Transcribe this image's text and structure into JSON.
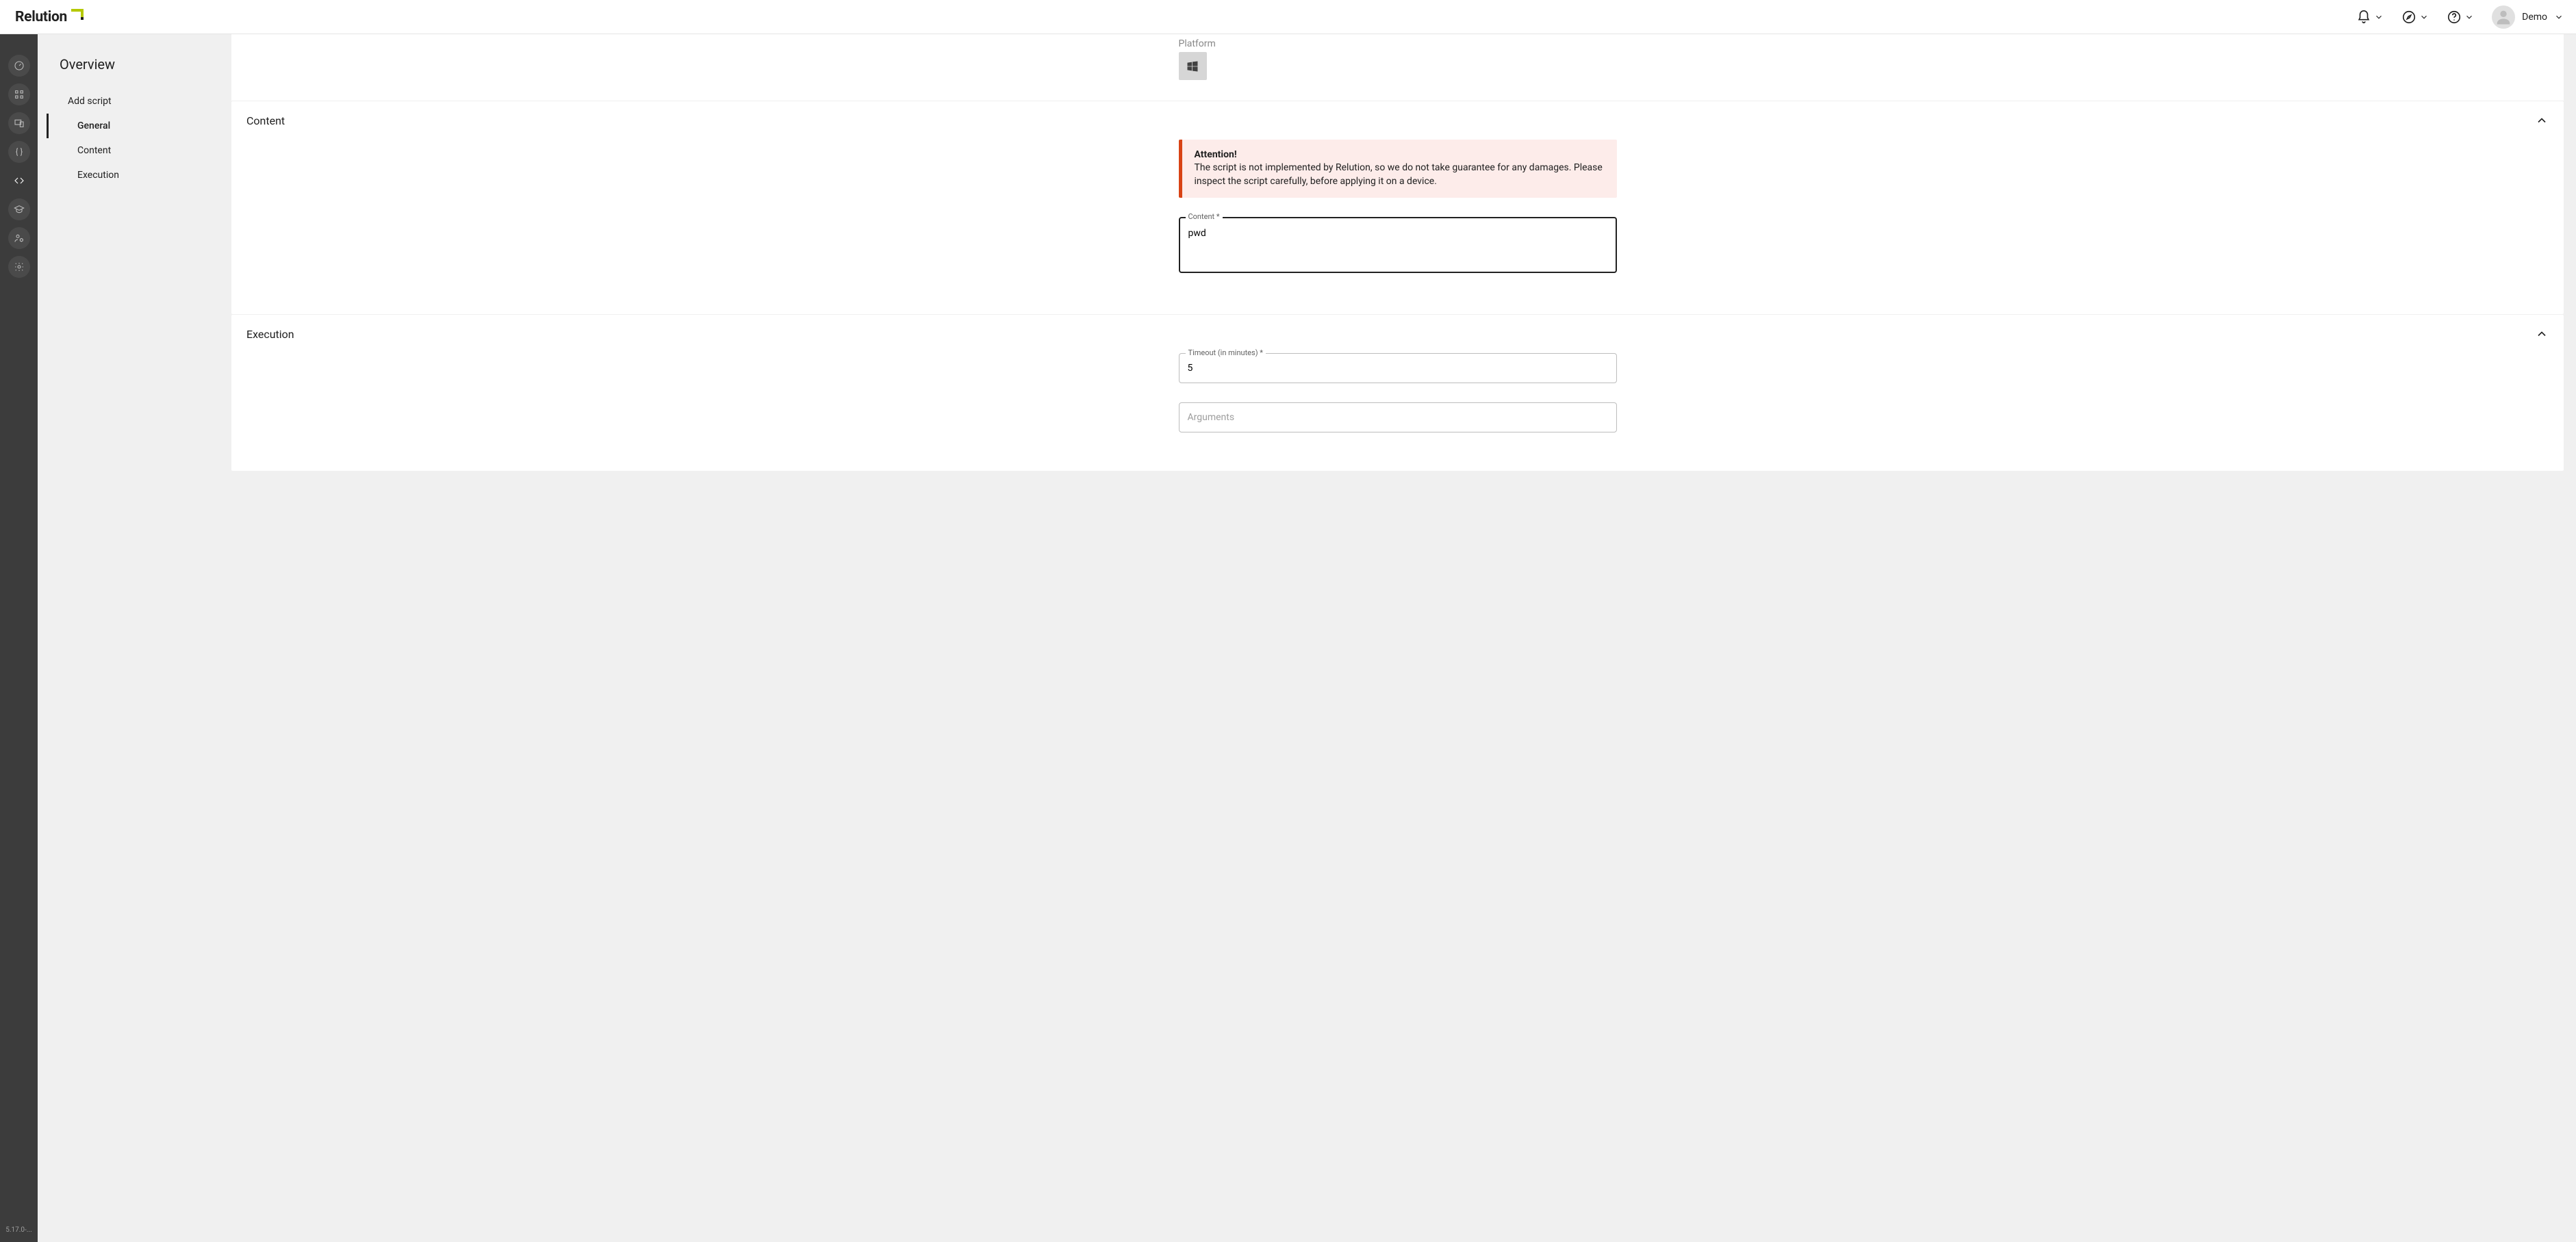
{
  "brand": {
    "name": "Relution"
  },
  "header": {
    "user_name": "Demo"
  },
  "rail": {
    "version": "5.17.0-..."
  },
  "sidenav": {
    "title": "Overview",
    "items": {
      "add_script": "Add script",
      "general": "General",
      "content": "Content",
      "execution": "Execution"
    }
  },
  "partial": {
    "label": "Platform"
  },
  "content_section": {
    "title": "Content",
    "alert_title": "Attention!",
    "alert_text": "The script is not implemented by Relution, so we do not take guarantee for any damages. Please inspect the script carefully, before applying it on a device.",
    "field_label": "Content *",
    "field_value": "pwd"
  },
  "execution_section": {
    "title": "Execution",
    "timeout_label": "Timeout (in minutes) *",
    "timeout_value": "5",
    "arguments_placeholder": "Arguments",
    "arguments_value": ""
  }
}
